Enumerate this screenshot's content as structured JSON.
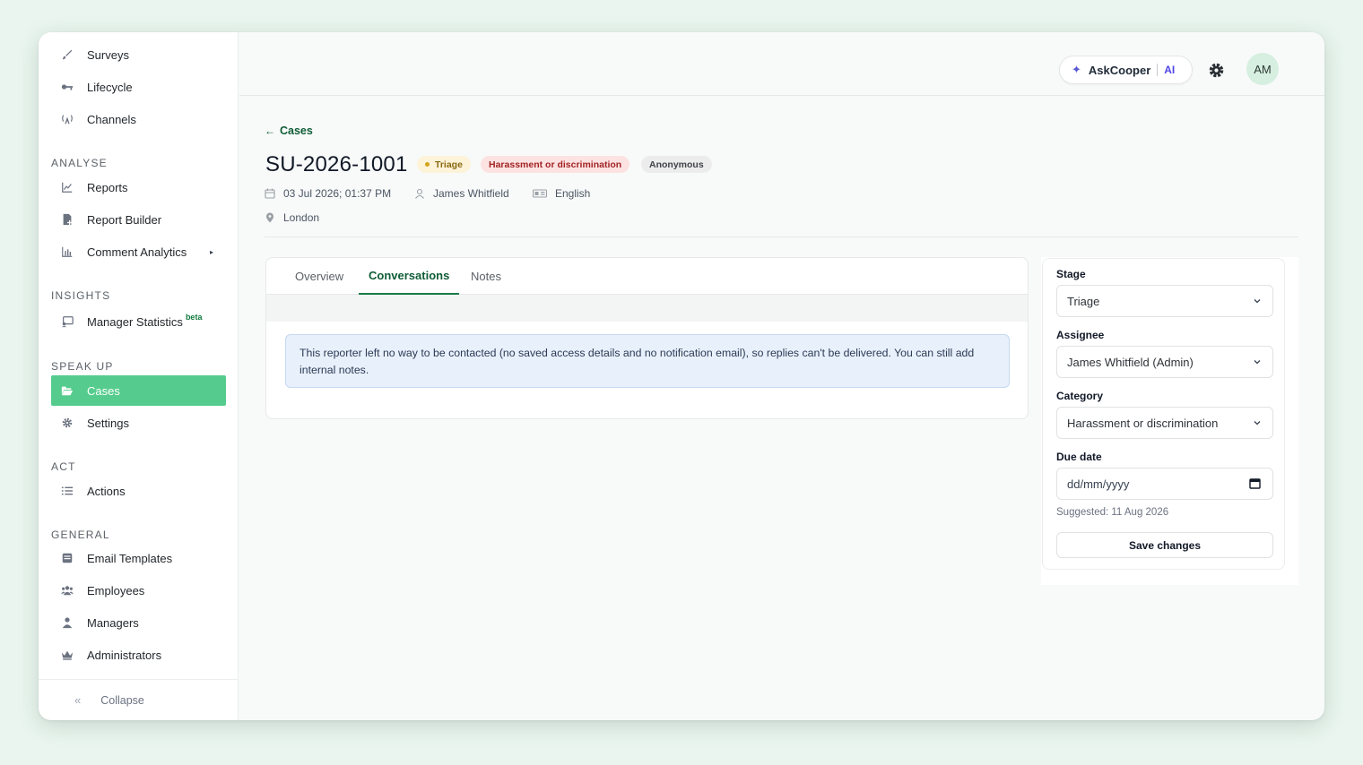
{
  "sidebar": {
    "items_top": [
      {
        "label": "Surveys",
        "icon": "brush-icon"
      },
      {
        "label": "Lifecycle",
        "icon": "key-icon"
      },
      {
        "label": "Channels",
        "icon": "broadcast-icon"
      }
    ],
    "sections": {
      "analyse": "ANALYSE",
      "insights": "INSIGHTS",
      "speak_up": "SPEAK UP",
      "act": "ACT",
      "general": "GENERAL"
    },
    "analyse_items": [
      {
        "label": "Reports"
      },
      {
        "label": "Report Builder"
      },
      {
        "label": "Comment Analytics",
        "caret": "▸"
      }
    ],
    "insights_items": [
      {
        "label": "Manager Statistics",
        "badge": "beta"
      }
    ],
    "speak_up_items": [
      {
        "label": "Cases",
        "active": true
      },
      {
        "label": "Settings"
      }
    ],
    "act_items": [
      {
        "label": "Actions"
      }
    ],
    "general_items": [
      {
        "label": "Email Templates"
      },
      {
        "label": "Employees"
      },
      {
        "label": "Managers"
      },
      {
        "label": "Administrators"
      }
    ],
    "collapse_label": "Collapse",
    "collapse_chevron": "«"
  },
  "header": {
    "askcooper_label": "AskCooper",
    "askcooper_ai": "AI",
    "avatar_initials": "AM",
    "avatar_caret": "⌄"
  },
  "case": {
    "back_label": "Cases",
    "back_arrow": "←",
    "id": "SU-2026-1001",
    "badges": {
      "stage": "Triage",
      "category": "Harassment or discrimination",
      "anonymity": "Anonymous"
    },
    "date": "03 Jul 2026; 01:37 PM",
    "assignee": "James Whitfield",
    "language": "English",
    "location": "London"
  },
  "tabs": [
    {
      "label": "Overview"
    },
    {
      "label": "Conversations",
      "active": true
    },
    {
      "label": "Notes"
    }
  ],
  "notice": "This reporter left no way to be contacted (no saved access details and no notification email), so replies can't be delivered. You can still add internal notes.",
  "panel": {
    "stage_label": "Stage",
    "stage_value": "Triage",
    "assignee_label": "Assignee",
    "assignee_value": "James Whitfield (Admin)",
    "category_label": "Category",
    "category_value": "Harassment or discrimination",
    "due_label": "Due date",
    "due_placeholder": "dd/mm/yyyy",
    "suggested": "Suggested: 11 Aug 2026",
    "save_label": "Save changes"
  },
  "colors": {
    "accent": "#55cc8d",
    "brand_dark": "#0f5c36",
    "triage_bg": "#fdf3d9",
    "category_bg": "#fde2e2",
    "notice_bg": "#e8f0fb"
  }
}
